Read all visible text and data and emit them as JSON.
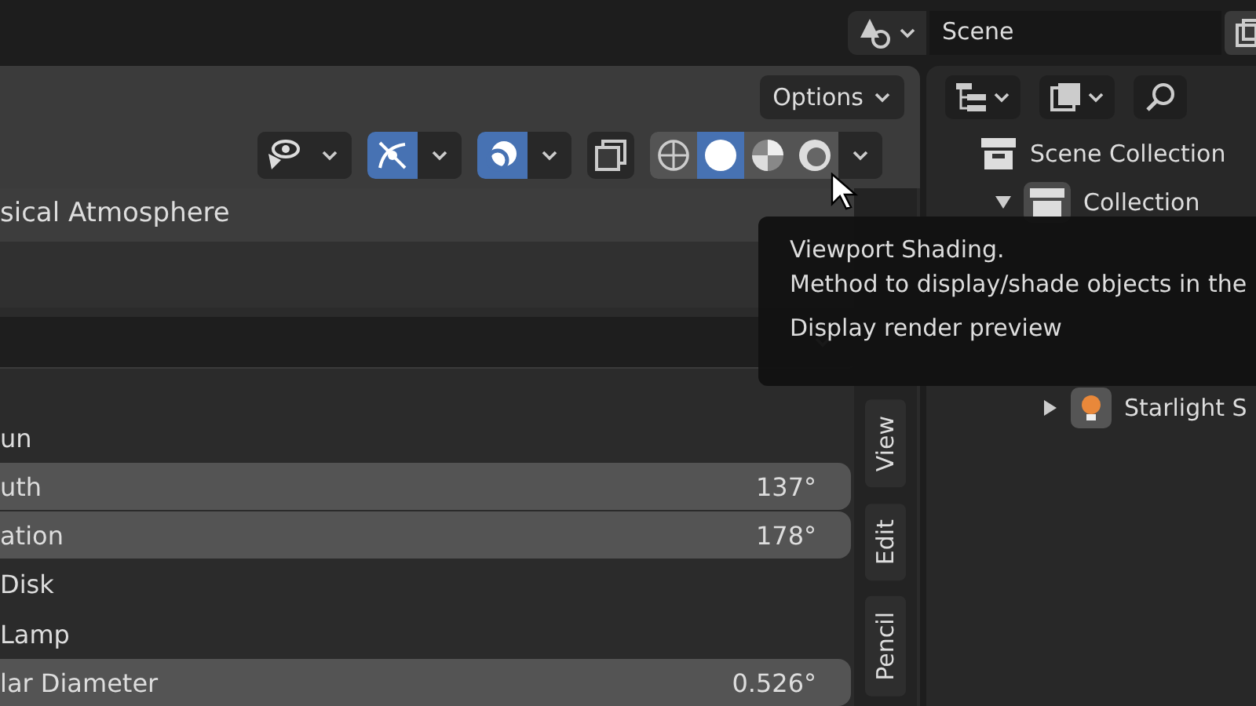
{
  "topbar": {
    "scene": "Scene"
  },
  "viewport_header": {
    "options": "Options",
    "toggles": [
      {
        "kind": "visibility",
        "selected": false
      },
      {
        "kind": "gizmo",
        "selected": true
      },
      {
        "kind": "overlay",
        "selected": true
      },
      {
        "kind": "xray",
        "selected": false
      }
    ],
    "shading_modes": [
      {
        "kind": "wireframe",
        "selected": false
      },
      {
        "kind": "solid",
        "selected": true
      },
      {
        "kind": "material",
        "selected": false
      },
      {
        "kind": "rendered",
        "selected": false
      }
    ]
  },
  "panel": {
    "title": "sical Atmosphere",
    "rows": [
      {
        "kind": "dropdown"
      },
      {
        "kind": "label",
        "label": "un"
      },
      {
        "kind": "field",
        "label": "uth",
        "value": "137°"
      },
      {
        "kind": "field",
        "label": "ation",
        "value": "178°"
      },
      {
        "kind": "label",
        "label": "Disk"
      },
      {
        "kind": "label",
        "label": "Lamp"
      },
      {
        "kind": "field",
        "label": "lar Diameter",
        "value": "0.526°"
      }
    ]
  },
  "sidebar_tabs": [
    {
      "label": "View",
      "selected": false
    },
    {
      "label": "Edit",
      "selected": false
    },
    {
      "label": "Pencil",
      "selected": false
    }
  ],
  "outliner": {
    "tree": [
      {
        "label": "Scene Collection",
        "kind": "scene",
        "children": [
          {
            "label": "Collection",
            "kind": "collection",
            "expanded": true,
            "children": [
              {
                "label": "Starlight S",
                "kind": "object",
                "expanded": false
              }
            ]
          }
        ]
      }
    ]
  },
  "tooltip": {
    "title": "Viewport Shading.",
    "description": "Method to display/shade objects in the",
    "hint": "Display render preview"
  }
}
